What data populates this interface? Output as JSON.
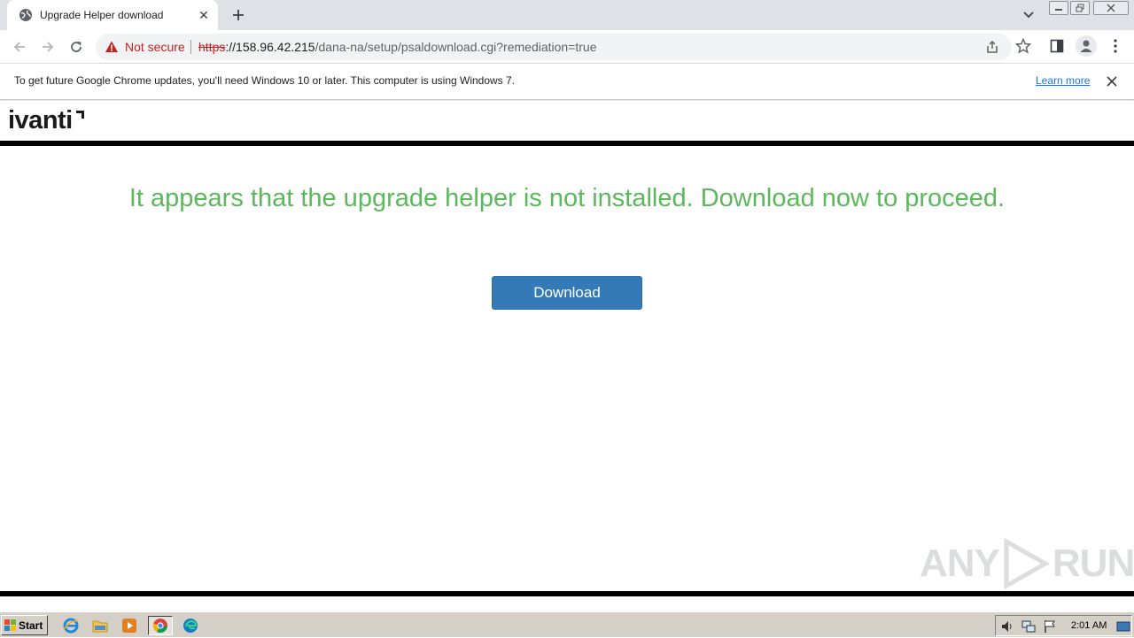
{
  "browser": {
    "tab": {
      "title": "Upgrade Helper download",
      "favicon": "globe-icon",
      "close_glyph": "✕"
    },
    "new_tab_glyph": "+",
    "address": {
      "security_label": "Not secure",
      "url_scheme": "https",
      "url_host": "://158.96.42.215",
      "url_path": "/dana-na/setup/psaldownload.cgi?remediation=true"
    },
    "infobar": {
      "message": "To get future Google Chrome updates, you'll need Windows 10 or later. This computer is using Windows 7.",
      "link": "Learn more"
    }
  },
  "page": {
    "logo_text": "ivanti",
    "message": "It appears that the upgrade helper is not installed. Download now to proceed.",
    "download_label": "Download",
    "colors": {
      "message": "#5cb85c",
      "button": "#337ab7"
    }
  },
  "watermark": {
    "left": "ANY",
    "right": "RUN"
  },
  "taskbar": {
    "start_label": "Start",
    "clock": "2:01 AM",
    "pinned": [
      "ie-icon",
      "explorer-icon",
      "media-player-icon",
      "chrome-icon",
      "edge-icon"
    ]
  }
}
